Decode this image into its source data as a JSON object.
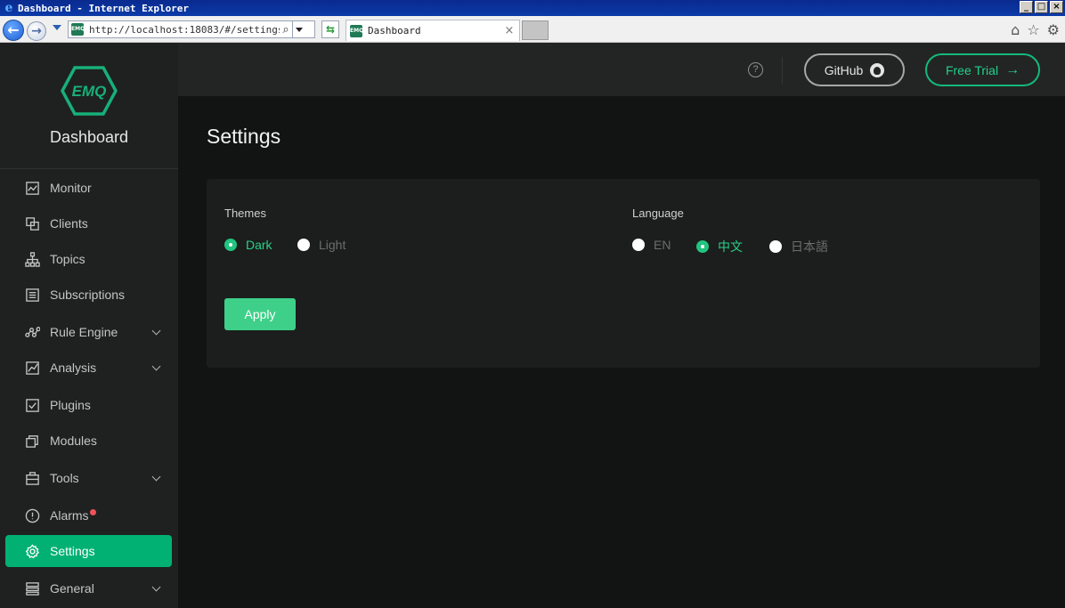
{
  "browser": {
    "window_title": "Dashboard - Internet Explorer",
    "url": "http://localhost:18083/#/settings",
    "tab_title": "Dashboard",
    "favicon_text": "EMQ"
  },
  "brand": {
    "logo_text": "EMQ",
    "name": "Dashboard",
    "accent_color": "#00b173"
  },
  "sidebar": {
    "items": [
      {
        "label": "Monitor",
        "icon": "monitor-icon",
        "expandable": false,
        "active": false
      },
      {
        "label": "Clients",
        "icon": "clients-icon",
        "expandable": false,
        "active": false
      },
      {
        "label": "Topics",
        "icon": "topics-icon",
        "expandable": false,
        "active": false
      },
      {
        "label": "Subscriptions",
        "icon": "subscriptions-icon",
        "expandable": false,
        "active": false
      },
      {
        "label": "Rule Engine",
        "icon": "rule-engine-icon",
        "expandable": true,
        "active": false
      },
      {
        "label": "Analysis",
        "icon": "analysis-icon",
        "expandable": true,
        "active": false
      },
      {
        "label": "Plugins",
        "icon": "plugins-icon",
        "expandable": false,
        "active": false
      },
      {
        "label": "Modules",
        "icon": "modules-icon",
        "expandable": false,
        "active": false
      },
      {
        "label": "Tools",
        "icon": "tools-icon",
        "expandable": true,
        "active": false
      },
      {
        "label": "Alarms",
        "icon": "alarm-icon",
        "expandable": false,
        "active": false,
        "badge_color": "#f3525a"
      },
      {
        "label": "Settings",
        "icon": "gear-icon",
        "expandable": false,
        "active": true
      },
      {
        "label": "General",
        "icon": "general-icon",
        "expandable": true,
        "active": false
      }
    ]
  },
  "header": {
    "help_label": "?",
    "github_label": "GitHub",
    "free_trial_label": "Free Trial"
  },
  "page": {
    "title": "Settings",
    "themes": {
      "label": "Themes",
      "options": [
        "Dark",
        "Light"
      ],
      "selected": "Dark"
    },
    "language": {
      "label": "Language",
      "options": [
        "EN",
        "中文",
        "日本語"
      ],
      "selected": "中文"
    },
    "apply_label": "Apply"
  }
}
